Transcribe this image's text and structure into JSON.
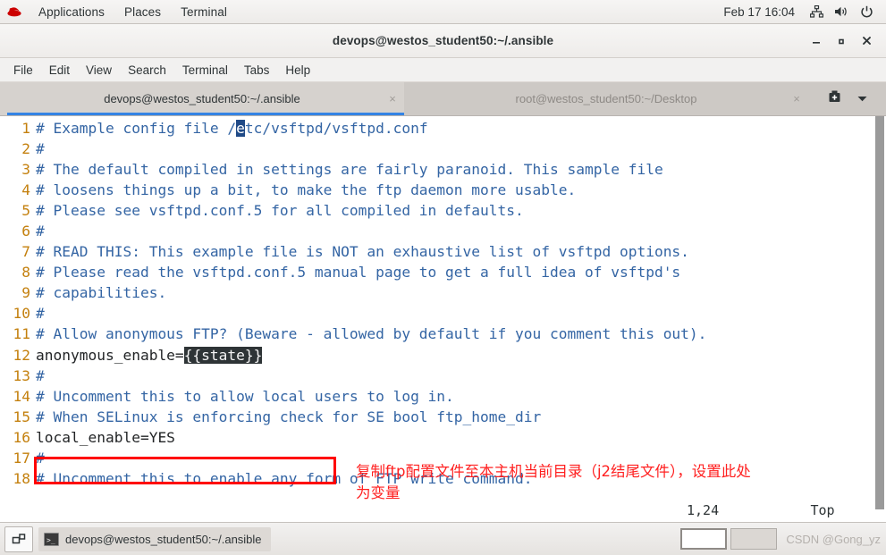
{
  "gnome_panel": {
    "logo": "redhat-logo",
    "items": [
      {
        "label": "Applications"
      },
      {
        "label": "Places"
      },
      {
        "label": "Terminal"
      }
    ],
    "clock": "Feb 17  16:04",
    "tray": [
      {
        "icon": "network-icon"
      },
      {
        "icon": "volume-icon"
      },
      {
        "icon": "power-icon"
      }
    ]
  },
  "window": {
    "title": "devops@westos_student50:~/.ansible",
    "buttons": {
      "minimize": "–",
      "maximize": "□",
      "close": "✕"
    },
    "menubar": [
      {
        "label": "File"
      },
      {
        "label": "Edit"
      },
      {
        "label": "View"
      },
      {
        "label": "Search"
      },
      {
        "label": "Terminal"
      },
      {
        "label": "Tabs"
      },
      {
        "label": "Help"
      }
    ],
    "tabs": [
      {
        "label": "devops@westos_student50:~/.ansible",
        "close": "×",
        "active": true
      },
      {
        "label": "root@westos_student50:~/Desktop",
        "close": "×",
        "active": false
      }
    ],
    "tab_actions": {
      "new_tab": "new-tab-icon",
      "tab_menu": "▼"
    }
  },
  "terminal": {
    "lines": [
      {
        "num": "1",
        "segments": [
          {
            "text": "# Example config file /",
            "style": "comment"
          },
          {
            "text": "e",
            "style": "cursor"
          },
          {
            "text": "tc/vsftpd/vsftpd.conf",
            "style": "comment"
          }
        ]
      },
      {
        "num": "2",
        "segments": [
          {
            "text": "#",
            "style": "comment"
          }
        ]
      },
      {
        "num": "3",
        "segments": [
          {
            "text": "# The default compiled in settings are fairly paranoid. This sample file",
            "style": "comment"
          }
        ]
      },
      {
        "num": "4",
        "segments": [
          {
            "text": "# loosens things up a bit, to make the ftp daemon more usable.",
            "style": "comment"
          }
        ]
      },
      {
        "num": "5",
        "segments": [
          {
            "text": "# Please see vsftpd.conf.5 for all compiled in defaults.",
            "style": "comment"
          }
        ]
      },
      {
        "num": "6",
        "segments": [
          {
            "text": "#",
            "style": "comment"
          }
        ]
      },
      {
        "num": "7",
        "segments": [
          {
            "text": "# READ THIS: This example file is NOT an exhaustive list of vsftpd options.",
            "style": "comment"
          }
        ]
      },
      {
        "num": "8",
        "segments": [
          {
            "text": "# Please read the vsftpd.conf.5 manual page to get a full idea of vsftpd's",
            "style": "comment"
          }
        ]
      },
      {
        "num": "9",
        "segments": [
          {
            "text": "# capabilities.",
            "style": "comment"
          }
        ]
      },
      {
        "num": "10",
        "segments": [
          {
            "text": "#",
            "style": "comment"
          }
        ]
      },
      {
        "num": "11",
        "segments": [
          {
            "text": "# Allow anonymous FTP? (Beware - allowed by default if you comment this out).",
            "style": "comment"
          }
        ]
      },
      {
        "num": "12",
        "segments": [
          {
            "text": "anonymous_enable=",
            "style": "plain"
          },
          {
            "text": "{{state}}",
            "style": "varhl"
          }
        ]
      },
      {
        "num": "13",
        "segments": [
          {
            "text": "#",
            "style": "comment"
          }
        ]
      },
      {
        "num": "14",
        "segments": [
          {
            "text": "# Uncomment this to allow local users to log in.",
            "style": "comment"
          }
        ]
      },
      {
        "num": "15",
        "segments": [
          {
            "text": "# When SELinux is enforcing check for SE bool ftp_home_dir",
            "style": "comment"
          }
        ]
      },
      {
        "num": "16",
        "segments": [
          {
            "text": "local_enable=YES",
            "style": "plain"
          }
        ]
      },
      {
        "num": "17",
        "segments": [
          {
            "text": "#",
            "style": "comment"
          }
        ]
      },
      {
        "num": "18",
        "segments": [
          {
            "text": "# Uncomment this to enable any form of FTP write command.",
            "style": "comment"
          }
        ]
      }
    ],
    "status": {
      "position": "1,24",
      "scroll": "Top"
    }
  },
  "annotations": {
    "highlight_box": "anonymous_enable={{state}}",
    "note": "复制ftp配置文件至本主机当前目录（j2结尾文件），设置此处\n为变量"
  },
  "taskbar": {
    "show_desktop": "show-desktop-icon",
    "windows": [
      {
        "label": "devops@westos_student50:~/.ansible"
      }
    ],
    "workspaces": [
      {
        "active": true
      },
      {
        "active": false
      }
    ],
    "watermark": "CSDN @Gong_yz"
  },
  "colors": {
    "accent": "#3584e4",
    "comment": "#3465a4",
    "linenum": "#c4800e",
    "annotation": "#ff2020",
    "cursor": "#204a87"
  }
}
